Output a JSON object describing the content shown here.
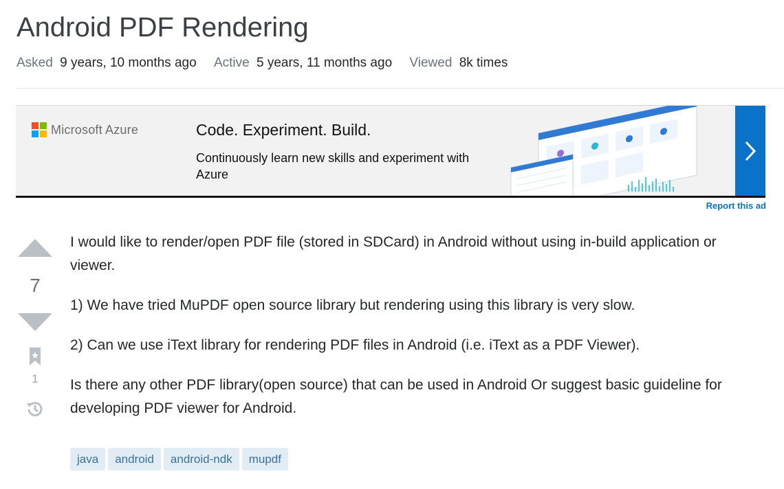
{
  "question": {
    "title": "Android PDF Rendering",
    "meta": [
      {
        "key": "Asked",
        "value": "9 years, 10 months ago"
      },
      {
        "key": "Active",
        "value": "5 years, 11 months ago"
      },
      {
        "key": "Viewed",
        "value": "8k times"
      }
    ],
    "votes": "7",
    "bookmarks": "1",
    "body": [
      "I would like to render/open PDF file (stored in SDCard) in Android without using in-build application or viewer.",
      "1) We have tried MuPDF open source library but rendering using this library is very slow.",
      "2) Can we use iText library for rendering PDF files in Android (i.e. iText as a PDF Viewer).",
      "Is there any other PDF library(open source) that can be used in Android Or suggest basic guideline for developing PDF viewer for Android."
    ],
    "tags": [
      "java",
      "android",
      "android-ndk",
      "mupdf"
    ]
  },
  "ad": {
    "brand": "Microsoft Azure",
    "headline": "Code. Experiment. Build.",
    "body": "Continuously learn new skills and experiment with Azure",
    "report_label": "Report this ad",
    "cta_icon": "chevron-right-icon",
    "colors": {
      "cta": "#0a72c8",
      "ms_red": "#f25022",
      "ms_green": "#7fba00",
      "ms_blue": "#00a4ef",
      "ms_yellow": "#ffb900"
    }
  },
  "icons": {
    "vote_up": "vote-up-icon",
    "vote_down": "vote-down-icon",
    "bookmark": "bookmark-icon",
    "history": "history-icon"
  }
}
